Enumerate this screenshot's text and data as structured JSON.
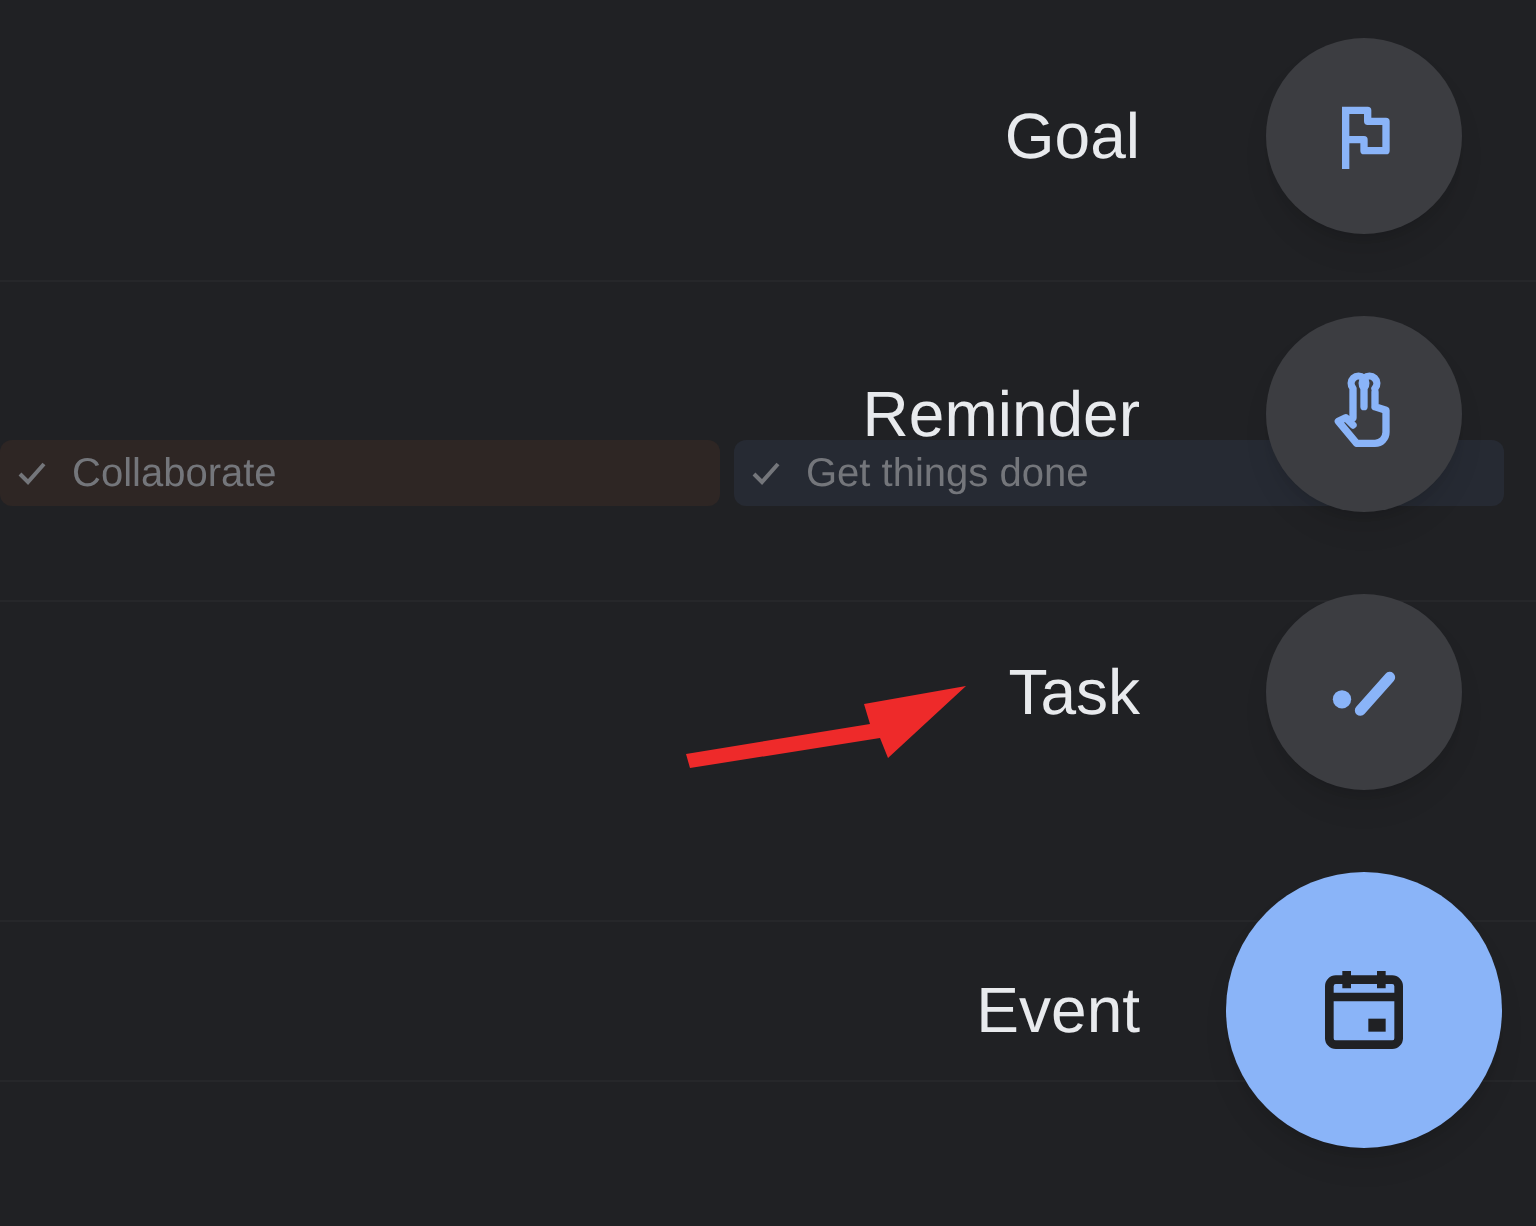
{
  "background_chips": [
    {
      "label": "Collaborate",
      "color": "#2e2624"
    },
    {
      "label": "Get things done",
      "color": "#262a33"
    }
  ],
  "menu": [
    {
      "label": "Goal",
      "kind": "goal"
    },
    {
      "label": "Reminder",
      "kind": "reminder"
    },
    {
      "label": "Task",
      "kind": "task"
    },
    {
      "label": "Event",
      "kind": "event"
    }
  ]
}
